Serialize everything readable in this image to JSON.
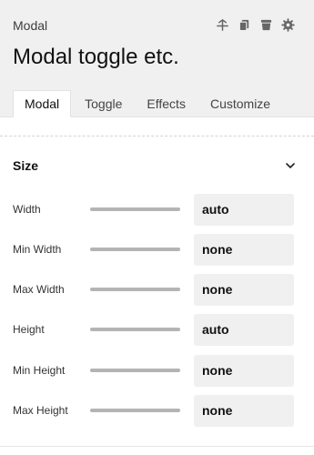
{
  "header": {
    "subtitle": "Modal",
    "title": "Modal toggle etc.",
    "icons": [
      "pin-icon",
      "copy-icon",
      "trash-icon",
      "gear-icon"
    ]
  },
  "tabs": [
    {
      "label": "Modal",
      "active": true
    },
    {
      "label": "Toggle",
      "active": false
    },
    {
      "label": "Effects",
      "active": false
    },
    {
      "label": "Customize",
      "active": false
    }
  ],
  "section": {
    "title": "Size",
    "expanded": true,
    "rows": [
      {
        "label": "Width",
        "value": "auto"
      },
      {
        "label": "Min Width",
        "value": "none"
      },
      {
        "label": "Max Width",
        "value": "none"
      },
      {
        "label": "Height",
        "value": "auto"
      },
      {
        "label": "Min Height",
        "value": "none"
      },
      {
        "label": "Max Height",
        "value": "none"
      }
    ]
  }
}
